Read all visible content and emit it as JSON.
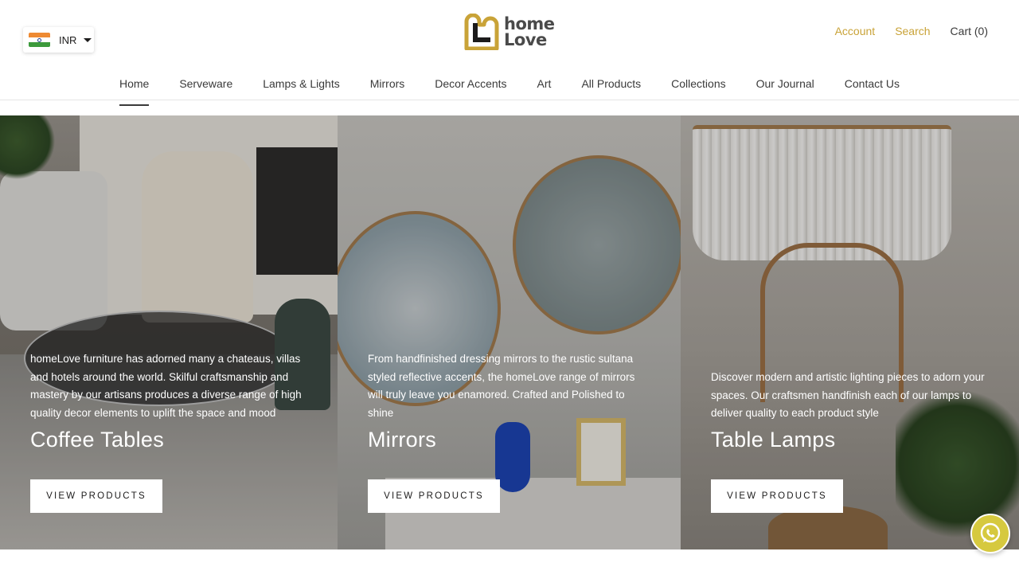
{
  "header": {
    "currency": {
      "code": "INR",
      "flag": "india-flag-icon"
    },
    "logo": {
      "line1": "home",
      "line2": "Love",
      "mark_color": "#c9a338"
    },
    "links": {
      "account": "Account",
      "search": "Search",
      "cart": "Cart (0)"
    }
  },
  "nav": {
    "items": [
      "Home",
      "Serveware",
      "Lamps & Lights",
      "Mirrors",
      "Decor Accents",
      "Art",
      "All Products",
      "Collections",
      "Our Journal",
      "Contact Us"
    ],
    "active": "Home"
  },
  "panels": [
    {
      "description": "homeLove furniture has adorned many a chateaus, villas and hotels around the world. Skilful craftsmanship and mastery by our artisans produces a diverse range of high quality decor elements to uplift the space and mood",
      "title": "Coffee Tables",
      "button": "VIEW PRODUCTS"
    },
    {
      "description": "From handfinished dressing mirrors to the rustic sultana styled reflective accents, the homeLove range of mirrors will truly leave you enamored. Crafted and Polished to shine",
      "title": "Mirrors",
      "button": "VIEW PRODUCTS"
    },
    {
      "description": "Discover modern and artistic lighting pieces to adorn your spaces. Our craftsmen handfinish each of our lamps to deliver quality to each product style",
      "title": "Table Lamps",
      "button": "VIEW PRODUCTS"
    }
  ],
  "colors": {
    "accent": "#c9a338",
    "whatsapp": "#d6c93f"
  },
  "chat_icon": "whatsapp-icon"
}
